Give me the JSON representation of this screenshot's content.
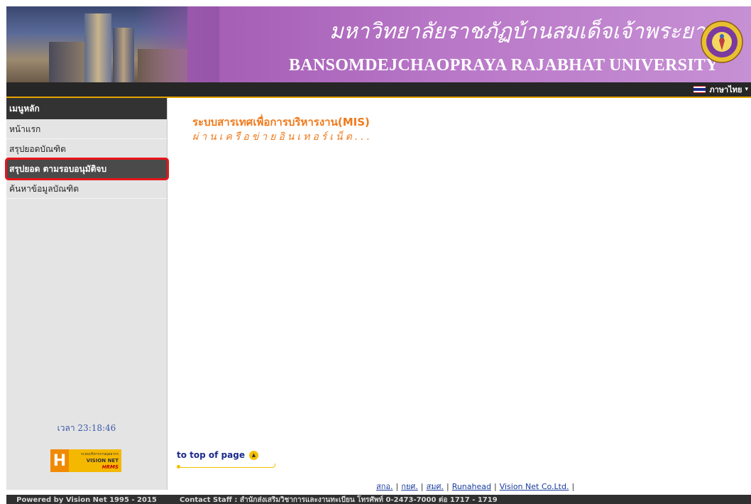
{
  "header": {
    "thai_name": "มหาวิทยาลัยราชภัฏบ้านสมเด็จเจ้าพระยา",
    "eng_name": "BANSOMDEJCHAOPRAYA  RAJABHAT  UNIVERSITY",
    "seal_icon": "university-seal-icon"
  },
  "langbar": {
    "language_label": "ภาษาไทย",
    "flag_icon": "thai-flag-icon"
  },
  "sidebar": {
    "menu_title": "เมนูหลัก",
    "items": [
      {
        "label": "หน้าแรก",
        "active": false
      },
      {
        "label": "สรุปยอดบัณฑิต",
        "active": false
      },
      {
        "label": "สรุปยอด ตามรอบอนุมัติจบ",
        "active": true
      },
      {
        "label": "ค้นหาข้อมูลบัณฑิต",
        "active": false
      }
    ],
    "clock": "เวลา 23:18:46",
    "badge": {
      "small_text": "ระบบบริหารงานบุคลากร",
      "big_text": "VISION NET",
      "sub_text": "HRMS"
    }
  },
  "main": {
    "title": "ระบบสารเทศเพื่อการบริหารงาน(MIS)",
    "subtitle": "ผ่านเครือข่ายอินเทอร์เน็ต...",
    "to_top": "to top of page"
  },
  "footer": {
    "links": [
      "สกอ.",
      "กยศ.",
      "สมศ.",
      "Runahead",
      "Vision Net Co.Ltd."
    ],
    "powered": "Powered by Vision Net  1995 - 2015",
    "contact": "Contact Staff : สำนักส่งเสริมวิชาการและงานทะเบียน โทรศัพท์ 0-2473-7000 ต่อ 1717 - 1719"
  },
  "colors": {
    "accent_orange": "#f07a1c",
    "banner_purple": "#a660b6",
    "active_outline": "#e8151a"
  }
}
